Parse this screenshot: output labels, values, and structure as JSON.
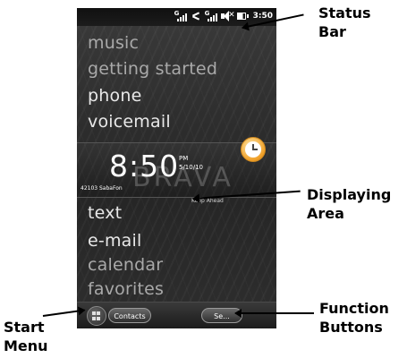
{
  "status_bar": {
    "signal1_label": "G",
    "signal2_label": "G",
    "time": "3:50"
  },
  "menu_top": [
    "music",
    "getting started",
    "phone",
    "voicemail"
  ],
  "clock": {
    "time": "8:50",
    "ampm": "PM",
    "date": "5/10/10",
    "operator": "42103 SabaFon",
    "watermark": "BRAVA",
    "tagline": "Keep Ahead"
  },
  "menu_bottom": [
    "text",
    "e-mail",
    "calendar",
    "favorites"
  ],
  "softkeys": {
    "left": "Contacts",
    "right": "Se..."
  },
  "annotations": {
    "status_bar": "Status Bar",
    "displaying_area": "Displaying Area",
    "function_buttons": "Function Buttons",
    "start_menu": "Start Menu"
  },
  "colors": {
    "background": "#2c2c2c",
    "menu_text": "#e8e8e8",
    "menu_text_dim": "#a9a9a9",
    "clock_accent": "#f0a028"
  }
}
